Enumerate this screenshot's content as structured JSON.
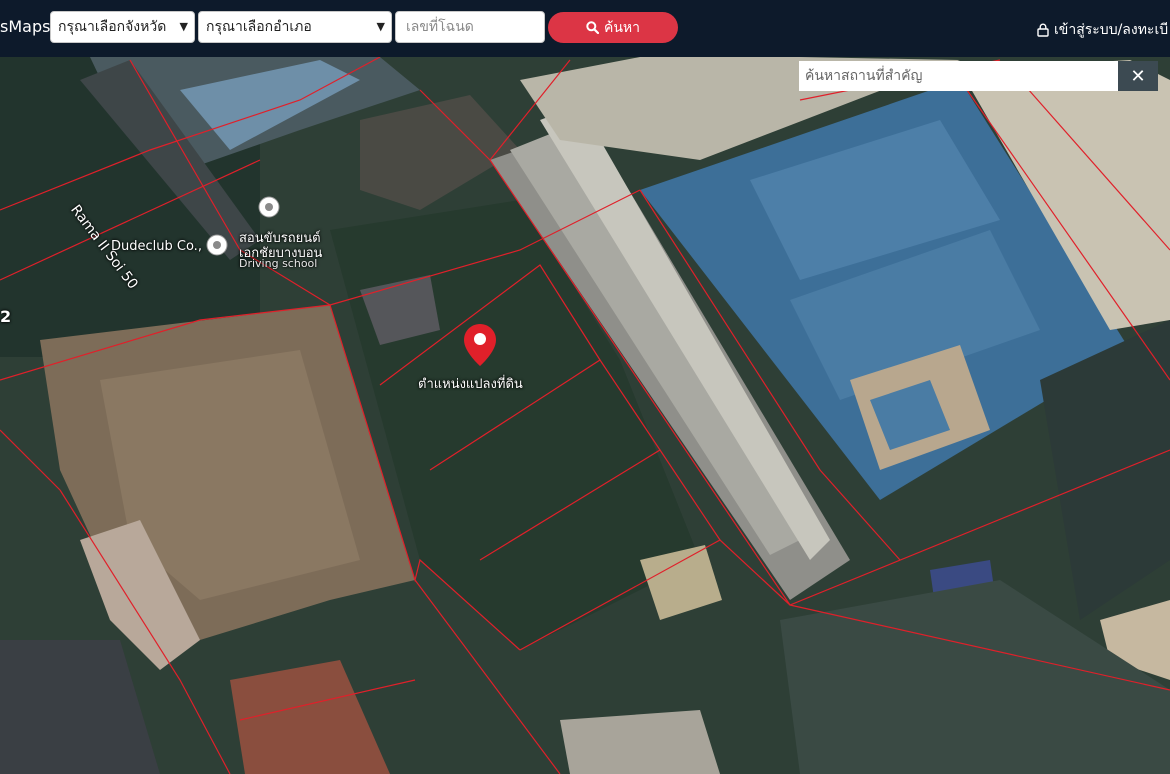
{
  "header": {
    "brand": "sMaps",
    "province_select": "กรุณาเลือกจังหวัด",
    "district_select": "กรุณาเลือกอำเภอ",
    "deed_placeholder": "เลขที่โฉนด",
    "search_label": "ค้นหา",
    "login_label": "เข้าสู่ระบบ/ลงทะเบี"
  },
  "map": {
    "place_search_placeholder": "ค้นหาสถานที่สำคัญ",
    "close_symbol": "✕",
    "street_label": "Rama II Soi 50",
    "poi_dudeclub": "Dudeclub Co.,",
    "poi_school_line1": "สอนขับรถยนต์",
    "poi_school_line2": "เอกชัยบางบอน",
    "poi_school_type": "Driving school",
    "parcel_label": "ตำแหน่งแปลงที่ดิน",
    "edge_number": "2",
    "parcel_line_color": "#e0202a",
    "marker_color": "#e0202a"
  }
}
